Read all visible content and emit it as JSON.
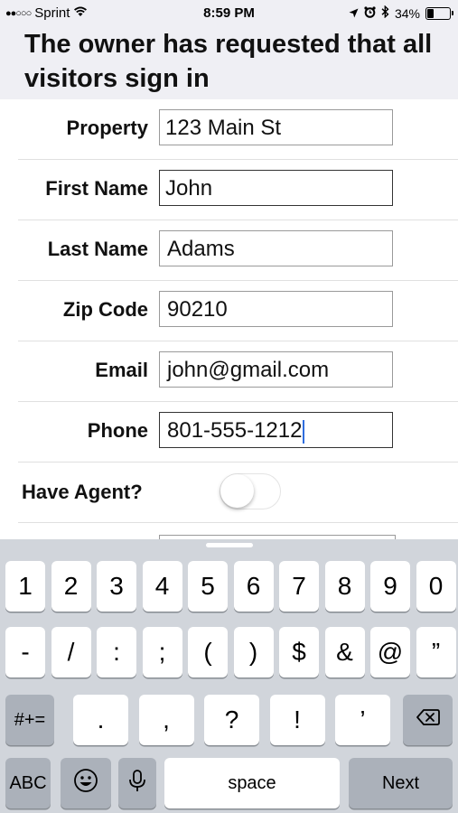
{
  "status_bar": {
    "carrier": "Sprint",
    "signal_dots": "●●○○○",
    "time": "8:59 PM",
    "battery_percent": "34%",
    "battery_level": 0.34,
    "icons": [
      "signal-icon",
      "wifi-icon",
      "location-icon",
      "alarm-icon",
      "bluetooth-icon",
      "battery-icon"
    ]
  },
  "header": {
    "title": "The owner has requested that all visitors sign in"
  },
  "form": {
    "fields": [
      {
        "label": "Property",
        "value": "123 Main St"
      },
      {
        "label": "First Name",
        "value": "John"
      },
      {
        "label": "Last Name",
        "value": "Adams"
      },
      {
        "label": "Zip Code",
        "value": "90210"
      },
      {
        "label": "Email",
        "value": "john@gmail.com"
      },
      {
        "label": "Phone",
        "value": "801-555-1212"
      }
    ],
    "agent": {
      "label": "Have Agent?",
      "on": false
    }
  },
  "keyboard": {
    "row1": [
      "1",
      "2",
      "3",
      "4",
      "5",
      "6",
      "7",
      "8",
      "9",
      "0"
    ],
    "row2": [
      "-",
      "/",
      ":",
      ";",
      "(",
      ")",
      "$",
      "&",
      "@",
      "”"
    ],
    "row3_mode": "#+=",
    "row3": [
      ".",
      ",",
      "?",
      "!",
      "’"
    ],
    "mode_key": "ABC",
    "space": "space",
    "return": "Next",
    "icons": [
      "backspace-icon",
      "emoji-icon",
      "microphone-icon"
    ]
  },
  "colors": {
    "caret": "#2f6dde",
    "keyboard_bg": "#d1d5db",
    "header_bg": "#efeff4"
  }
}
